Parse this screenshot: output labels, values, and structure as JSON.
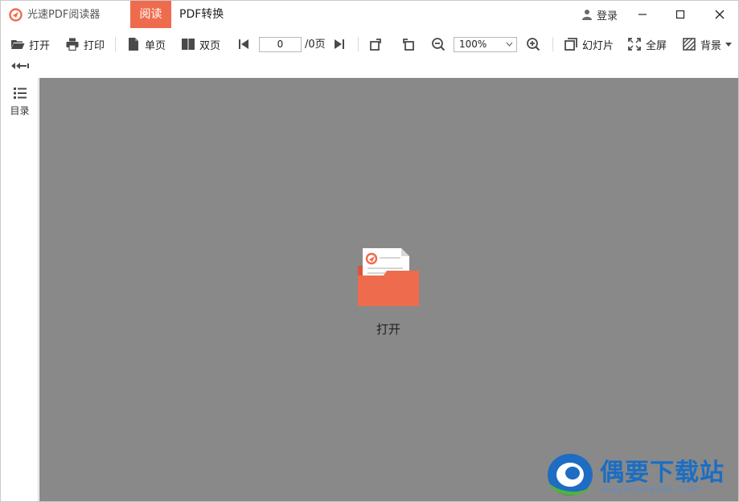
{
  "app": {
    "title": "光速PDF阅读器",
    "accent_color": "#ee6c4d"
  },
  "tabs": [
    {
      "label": "阅读",
      "active": true
    },
    {
      "label": "PDF转换",
      "active": false
    }
  ],
  "titlebar": {
    "login_label": "登录",
    "controls": [
      "minimize-icon",
      "maximize-icon",
      "close-icon"
    ]
  },
  "toolbar": {
    "open_label": "打开",
    "print_label": "打印",
    "single_page_label": "单页",
    "double_page_label": "双页",
    "page_value": "0",
    "page_total": "/0页",
    "zoom_value": "100%",
    "slideshow_label": "幻灯片",
    "fullscreen_label": "全屏",
    "background_label": "背景"
  },
  "sidebar": {
    "toc_label": "目录"
  },
  "content": {
    "background_color": "#898989",
    "open_label": "打开"
  },
  "watermark": {
    "title": "偶要下载站",
    "url": "ouyaoxiazai.com"
  }
}
